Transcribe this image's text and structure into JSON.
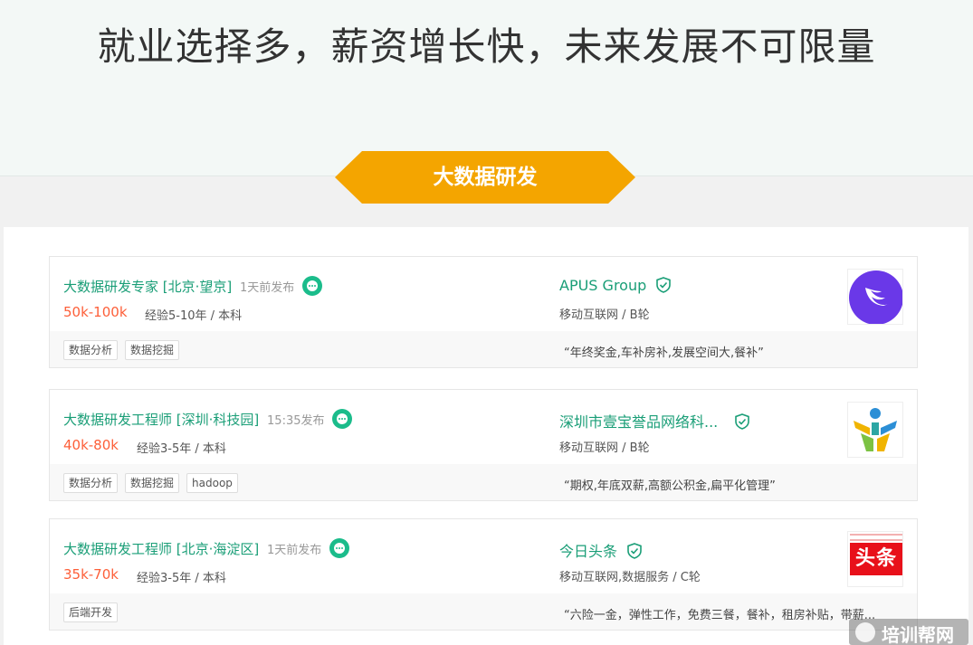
{
  "hero": {
    "title": "就业选择多，薪资增长快，未来发展不可限量"
  },
  "banner": {
    "label": "大数据研发",
    "color": "#f4a500"
  },
  "jobs": [
    {
      "title": "大数据研发专家 [北京·望京]",
      "time": "1天前发布",
      "salary": "50k-100k",
      "requirement": "经验5-10年 / 本科",
      "tags": [
        "数据分析",
        "数据挖掘"
      ],
      "company": "APUS Group",
      "industry": "移动互联网 / B轮",
      "benefit": "“年终奖金,车补房补,发展空间大,餐补”",
      "logo": "apus-logo"
    },
    {
      "title": "大数据研发工程师 [深圳·科技园]",
      "time": "15:35发布",
      "salary": "40k-80k",
      "requirement": "经验3-5年 / 本科",
      "tags": [
        "数据分析",
        "数据挖掘",
        "hadoop"
      ],
      "company": "深圳市壹宝誉品网络科...",
      "industry": "移动互联网 / B轮",
      "benefit": "“期权,年底双薪,高额公积金,扁平化管理”",
      "logo": "yibao-logo"
    },
    {
      "title": "大数据研发工程师 [北京·海淀区]",
      "time": "1天前发布",
      "salary": "35k-70k",
      "requirement": "经验3-5年 / 本科",
      "tags": [
        "后端开发"
      ],
      "company": "今日头条",
      "industry": "移动互联网,数据服务 / C轮",
      "benefit": "“六险一金，弹性工作，免费三餐，餐补，租房补贴，带薪...",
      "logo": "toutiao-logo",
      "logo_text": "头条"
    }
  ],
  "watermark": {
    "text": "培训帮网"
  },
  "colors": {
    "accent_green": "#1a9e77",
    "salary_orange": "#fd5f39",
    "chat_green": "#1bbc8b"
  }
}
